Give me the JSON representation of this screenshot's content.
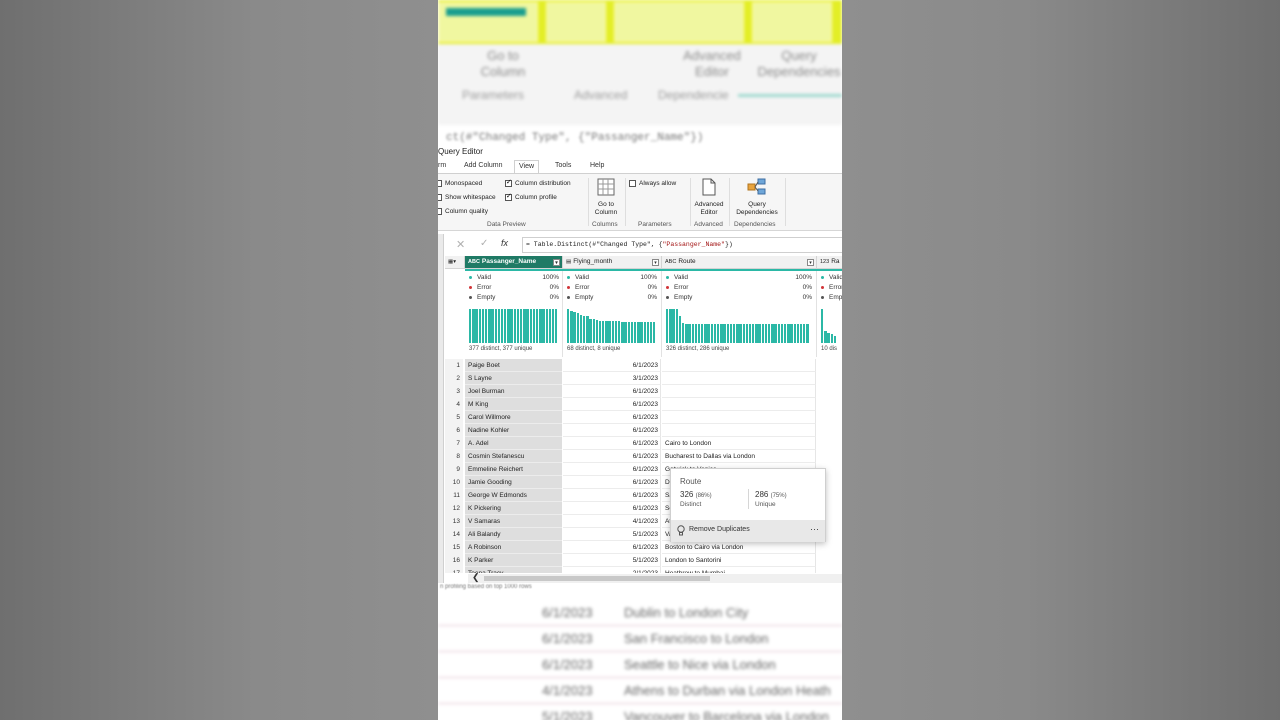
{
  "window": {
    "title": "Query Editor"
  },
  "tabs": [
    "rm",
    "Add Column",
    "View",
    "Tools",
    "Help"
  ],
  "active_tab": "View",
  "ribbon": {
    "checks": [
      {
        "label": "Monospaced",
        "checked": false
      },
      {
        "label": "Show whitespace",
        "checked": false
      },
      {
        "label": "Column quality",
        "checked": false
      },
      {
        "label": "Column distribution",
        "checked": true
      },
      {
        "label": "Column profile",
        "checked": true
      }
    ],
    "data_preview_label": "Data Preview",
    "go_to_column": "Go to Column",
    "columns_label": "Columns",
    "always_allow": "Always allow",
    "parameters_label": "Parameters",
    "advanced_editor": "Advanced Editor",
    "advanced_label": "Advanced",
    "query_dependencies": "Query Dependencies",
    "dependencies_label": "Dependencies"
  },
  "blurred_top": {
    "go_to_column": "Go to Column",
    "advanced_editor": "Advanced Editor",
    "query_dependencies": "Query Dependencies",
    "parameters": "Parameters",
    "advanced": "Advanced",
    "dependencies": "Dependencie",
    "formula_fragment": "ct(#\"Changed Type\", {\"Passanger_Name\"})"
  },
  "formula": {
    "prefix": "= Table.Distinct(#\"Changed Type\", {",
    "arg": "\"Passanger_Name\"",
    "suffix": "})"
  },
  "columns": [
    {
      "name": "Passanger_Name",
      "type_icon": "ABC",
      "valid": "100%",
      "error": "0%",
      "empty": "0%",
      "distinct_text": "377 distinct, 377 unique"
    },
    {
      "name": "Flying_month",
      "type_icon": "cal",
      "valid": "100%",
      "error": "0%",
      "empty": "0%",
      "distinct_text": "68 distinct, 8 unique"
    },
    {
      "name": "Route",
      "type_icon": "ABC",
      "valid": "100%",
      "error": "0%",
      "empty": "0%",
      "distinct_text": "326 distinct, 286 unique"
    },
    {
      "name": "Ra",
      "type_icon": "123",
      "valid": "",
      "error": "",
      "empty": "",
      "distinct_text": "10 dis"
    }
  ],
  "quality_labels": {
    "valid": "Valid",
    "error": "Error",
    "empty": "Empty"
  },
  "quality_colors": {
    "valid": "#2bb8a6",
    "error": "#d13438",
    "empty": "#555555"
  },
  "rows": [
    {
      "n": "1",
      "name": "Paige Boet",
      "month": "6/1/2023",
      "route": ""
    },
    {
      "n": "2",
      "name": "S Layne",
      "month": "3/1/2023",
      "route": ""
    },
    {
      "n": "3",
      "name": "Joel Burman",
      "month": "6/1/2023",
      "route": ""
    },
    {
      "n": "4",
      "name": "M King",
      "month": "6/1/2023",
      "route": ""
    },
    {
      "n": "5",
      "name": "Carol Willmore",
      "month": "6/1/2023",
      "route": ""
    },
    {
      "n": "6",
      "name": "Nadine Kohler",
      "month": "6/1/2023",
      "route": ""
    },
    {
      "n": "7",
      "name": "A. Adel",
      "month": "6/1/2023",
      "route": "Cairo to London"
    },
    {
      "n": "8",
      "name": "Cosmin Stefanescu",
      "month": "6/1/2023",
      "route": "Bucharest to Dallas via London"
    },
    {
      "n": "9",
      "name": "Emmeline Reichert",
      "month": "6/1/2023",
      "route": "Gatwick to Venice"
    },
    {
      "n": "10",
      "name": "Jamie Gooding",
      "month": "6/1/2023",
      "route": "Dublin to London City"
    },
    {
      "n": "11",
      "name": "George W Edmonds",
      "month": "6/1/2023",
      "route": "San Francisco to London"
    },
    {
      "n": "12",
      "name": "K Pickering",
      "month": "6/1/2023",
      "route": "Seattle to Nice via London"
    },
    {
      "n": "13",
      "name": "V Samaras",
      "month": "4/1/2023",
      "route": "Athens to Durban via London Heathrow"
    },
    {
      "n": "14",
      "name": "Ali Balandy",
      "month": "5/1/2023",
      "route": "Vancouver to Barcelona via London"
    },
    {
      "n": "15",
      "name": "A Robinson",
      "month": "6/1/2023",
      "route": "Boston to Cairo via London"
    },
    {
      "n": "16",
      "name": "K Parker",
      "month": "5/1/2023",
      "route": "London to Santorini"
    },
    {
      "n": "17",
      "name": "Teena Tracy",
      "month": "2/1/2023",
      "route": "Heathrow to Mumbai"
    }
  ],
  "popup": {
    "title": "Route",
    "distinct_value": "326",
    "distinct_pct": "(86%)",
    "distinct_label": "Distinct",
    "unique_value": "286",
    "unique_pct": "(75%)",
    "unique_label": "Unique",
    "action": "Remove Duplicates",
    "more": "···"
  },
  "status_text": "n profiling based on top 1000 rows",
  "blurred_bottom_rows": [
    {
      "month": "6/1/2023",
      "route": "Dublin to London City"
    },
    {
      "month": "6/1/2023",
      "route": "San Francisco to London"
    },
    {
      "month": "6/1/2023",
      "route": "Seattle to Nice via London"
    },
    {
      "month": "4/1/2023",
      "route": "Athens to Durban via London Heath"
    },
    {
      "month": "5/1/2023",
      "route": "Vancouver to Barcelona via London"
    }
  ],
  "distributions": {
    "Passanger_Name": [
      1,
      1,
      1,
      1,
      1,
      1,
      1,
      1,
      1,
      1,
      1,
      1,
      1,
      1,
      1,
      1,
      1,
      1,
      1,
      1,
      1,
      1,
      1,
      1,
      1,
      1,
      1,
      1
    ],
    "Flying_month": [
      1,
      0.95,
      0.9,
      0.88,
      0.82,
      0.8,
      0.78,
      0.72,
      0.7,
      0.68,
      0.66,
      0.66,
      0.65,
      0.65,
      0.64,
      0.64,
      0.64,
      0.63,
      0.63,
      0.63,
      0.62,
      0.62,
      0.62,
      0.62,
      0.62,
      0.62,
      0.62,
      0.62
    ],
    "Route": [
      1,
      1,
      1,
      1,
      0.8,
      0.6,
      0.55,
      0.55,
      0.55,
      0.55,
      0.55,
      0.55,
      0.55,
      0.55,
      0.55,
      0.55,
      0.55,
      0.55,
      0.55,
      0.55,
      0.55,
      0.55,
      0.55,
      0.55,
      0.55,
      0.55,
      0.55,
      0.55,
      0.55,
      0.55,
      0.55,
      0.55,
      0.55,
      0.55,
      0.55,
      0.55,
      0.55,
      0.55,
      0.55,
      0.55,
      0.55,
      0.55,
      0.55,
      0.55,
      0.55
    ],
    "Ra": [
      1,
      0.35,
      0.3,
      0.25,
      0.2
    ]
  }
}
